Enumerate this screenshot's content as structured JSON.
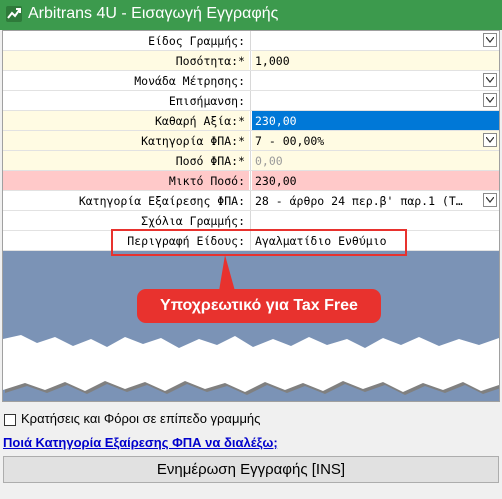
{
  "window": {
    "title": "Arbitrans 4U - Εισαγωγή Εγγραφής",
    "accent": "#3c9a4d"
  },
  "fields": [
    {
      "label": "Είδος Γραμμής:",
      "value": "",
      "required": false,
      "dropdown": true,
      "bg": "#ffffff"
    },
    {
      "label": "Ποσότητα:*",
      "value": "1,000",
      "required": true,
      "dropdown": false,
      "bg": "#fffbe3"
    },
    {
      "label": "Μονάδα Μέτρησης:",
      "value": "",
      "required": false,
      "dropdown": true,
      "bg": "#ffffff"
    },
    {
      "label": "Επισήμανση:",
      "value": "",
      "required": false,
      "dropdown": true,
      "bg": "#ffffff"
    },
    {
      "label": "Καθαρή Αξία:*",
      "value": "230,00",
      "required": true,
      "dropdown": false,
      "bg": "#fffbe3",
      "selected": true
    },
    {
      "label": "Κατηγορία ΦΠΑ:*",
      "value": "7 - 00,00%",
      "required": true,
      "dropdown": true,
      "bg": "#fffbe3"
    },
    {
      "label": "Ποσό ΦΠΑ:*",
      "value": "0,00",
      "required": true,
      "dropdown": false,
      "bg": "#fffbe3",
      "disabled": true
    },
    {
      "label": "Μικτό Ποσό:",
      "value": "230,00",
      "required": false,
      "dropdown": false,
      "bg": "#ffc9c9"
    },
    {
      "label": "Κατηγορία Εξαίρεσης ΦΠΑ:",
      "value": "28 - άρθρο 24 περ.β' παρ.1 (Τ…",
      "required": false,
      "dropdown": true,
      "bg": "#ffffff"
    },
    {
      "label": "Σχόλια Γραμμής:",
      "value": "",
      "required": false,
      "dropdown": false,
      "bg": "#ffffff"
    },
    {
      "label": "Περιγραφή Είδους:",
      "value": "Αγαλματίδιο Ενθύμιο",
      "required": false,
      "dropdown": false,
      "bg": "#ffffff"
    }
  ],
  "callout": {
    "text": "Υποχρεωτικό για Tax Free",
    "color": "#e8322e"
  },
  "options": {
    "checkbox_label": "Κρατήσεις και Φόροι σε επίπεδο γραμμής",
    "checked": false
  },
  "help_link": "Ποιά Κατηγορία Εξαίρεσης ΦΠΑ να διαλέξω;",
  "update_button": "Ενημέρωση Εγγραφής [INS]",
  "colors": {
    "selection": "#0078d7",
    "torn_area": "#7b93b6"
  }
}
